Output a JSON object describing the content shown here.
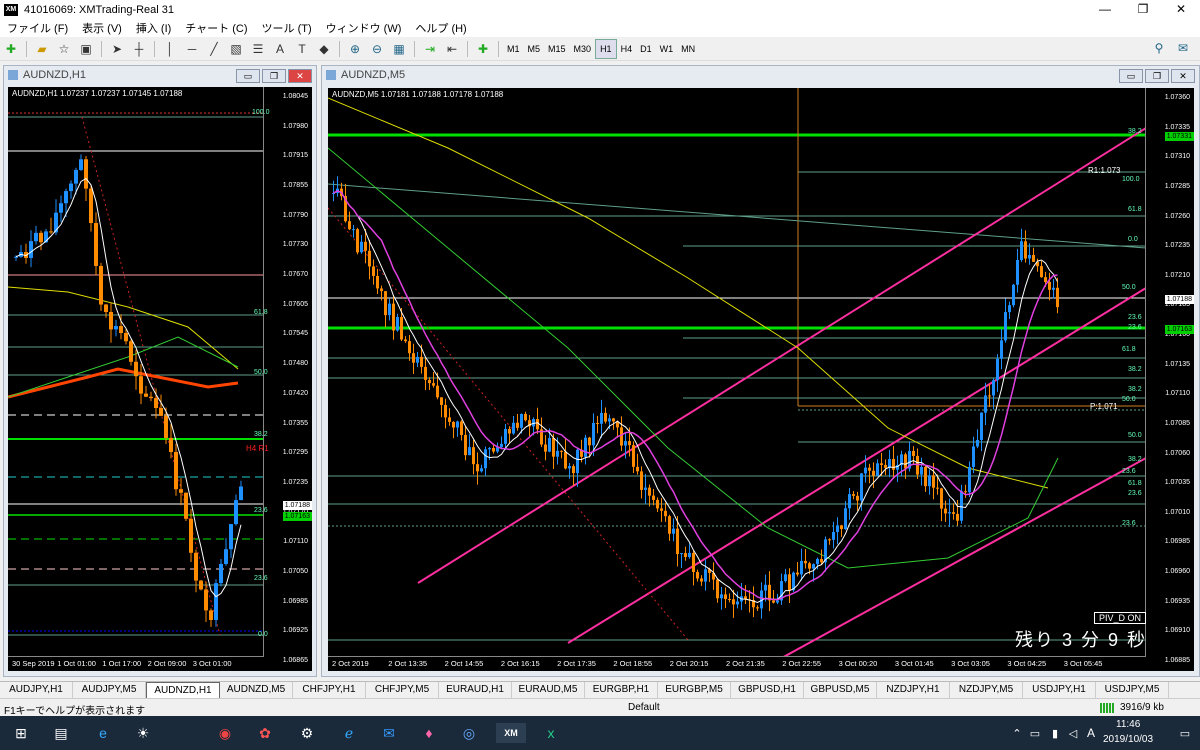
{
  "app": {
    "title": "41016069: XMTrading-Real 31",
    "logo": "XM"
  },
  "window_controls": [
    "—",
    "❐",
    "✕"
  ],
  "menu": [
    "ファイル (F)",
    "表示 (V)",
    "挿入 (I)",
    "チャート (C)",
    "ツール (T)",
    "ウィンドウ (W)",
    "ヘルプ (H)"
  ],
  "timeframes": [
    "M1",
    "M5",
    "M15",
    "M30",
    "H1",
    "H4",
    "D1",
    "W1",
    "MN"
  ],
  "active_timeframe": "H1",
  "left_chart": {
    "window_title": "AUDNZD,H1",
    "info": "AUDNZD,H1  1.07237 1.07237 1.07145 1.07188",
    "y_labels": [
      "1.08045",
      "1.07980",
      "1.07915",
      "1.07855",
      "1.07790",
      "1.07730",
      "1.07670",
      "1.07605",
      "1.07545",
      "1.07480",
      "1.07420",
      "1.07355",
      "1.07295",
      "1.07235",
      "1.07170",
      "1.07110",
      "1.07050",
      "1.06985",
      "1.06925",
      "1.06865"
    ],
    "x_labels": [
      "30 Sep 2019",
      "1 Oct 01:00",
      "1 Oct 17:00",
      "2 Oct 09:00",
      "3 Oct 01:00"
    ],
    "fib_labels": {
      "f100": "100.0",
      "f618": "61.8",
      "f500": "50.0",
      "f382": "38.2",
      "f236a": "23.6",
      "f236b": "23.6",
      "f0": "0.0"
    },
    "h4_label": "H4 R1",
    "price_tag": "1.07188",
    "green_tag": "1.07163"
  },
  "right_chart": {
    "window_title": "AUDNZD,M5",
    "info": "AUDNZD,M5  1.07181 1.07188 1.07178 1.07188",
    "y_labels": [
      "1.07360",
      "1.07335",
      "1.07310",
      "1.07285",
      "1.07260",
      "1.07235",
      "1.07210",
      "1.07185",
      "1.07160",
      "1.07135",
      "1.07110",
      "1.07085",
      "1.07060",
      "1.07035",
      "1.07010",
      "1.06985",
      "1.06960",
      "1.06935",
      "1.06910",
      "1.06885"
    ],
    "x_labels": [
      "2 Oct 2019",
      "2 Oct 13:35",
      "2 Oct 14:55",
      "2 Oct 16:15",
      "2 Oct 17:35",
      "2 Oct 18:55",
      "2 Oct 20:15",
      "2 Oct 21:35",
      "2 Oct 22:55",
      "3 Oct 00:20",
      "3 Oct 01:45",
      "3 Oct 03:05",
      "3 Oct 04:25",
      "3 Oct 05:45"
    ],
    "r1_label": "R1:1.073",
    "p_label": "P:1.071",
    "fib_labels": [
      "38.2",
      "100.0",
      "61.8",
      "0.0",
      "50.0",
      "23.6",
      "23.6",
      "61.8",
      "38.2",
      "38.2",
      "50.0",
      "50.0",
      "38.2",
      "23.6",
      "61.8",
      "23.6",
      "23.6"
    ],
    "price_tag": "1.07188",
    "green_tag_top": "1.07331",
    "green_tag_mid": "1.07163",
    "piv_badge": "PIV_D ON",
    "countdown": "残り 3 分 9 秒"
  },
  "tabs": [
    "AUDJPY,H1",
    "AUDJPY,M5",
    "AUDNZD,H1",
    "AUDNZD,M5",
    "CHFJPY,H1",
    "CHFJPY,M5",
    "EURAUD,H1",
    "EURAUD,M5",
    "EURGBP,H1",
    "EURGBP,M5",
    "GBPUSD,H1",
    "GBPUSD,M5",
    "NZDJPY,H1",
    "NZDJPY,M5",
    "USDJPY,H1",
    "USDJPY,M5"
  ],
  "active_tab": "AUDNZD,H1",
  "status": {
    "help": "F1キーでヘルプが表示されます",
    "profile": "Default",
    "traffic": "3916/9 kb"
  },
  "clock": {
    "time": "11:46",
    "date": "2019/10/03"
  },
  "colors": {
    "bull": "#1e90ff",
    "bear": "#ff8c00",
    "fib": "#5fa08a",
    "trend": "#ff2fa0",
    "level_green": "#00e000"
  }
}
